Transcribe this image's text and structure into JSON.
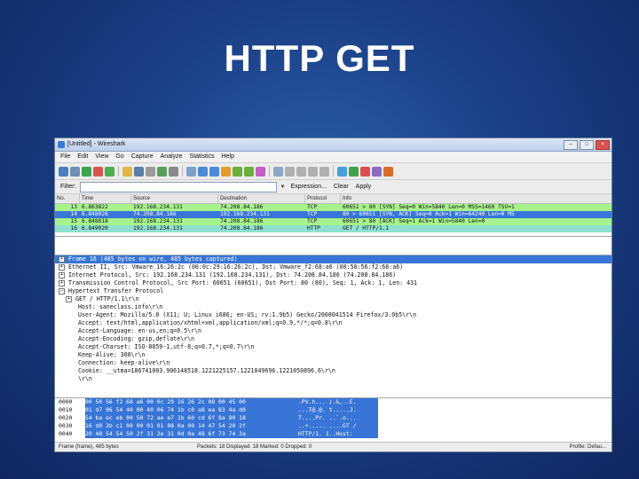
{
  "slide": {
    "title": "HTTP GET"
  },
  "window": {
    "title": "[Untitled] - Wireshark",
    "controls": {
      "minimize": "–",
      "maximize": "□",
      "close": "×"
    }
  },
  "menu": [
    "File",
    "Edit",
    "View",
    "Go",
    "Capture",
    "Analyze",
    "Statistics",
    "Help"
  ],
  "toolbar_icons": [
    {
      "name": "interfaces-icon",
      "color": "#4a7fbf"
    },
    {
      "name": "options-icon",
      "color": "#6f8fb3"
    },
    {
      "name": "start-capture-icon",
      "color": "#3fa34d"
    },
    {
      "name": "stop-capture-icon",
      "color": "#d9534f"
    },
    {
      "name": "restart-capture-icon",
      "color": "#4caf50"
    },
    {
      "name": "open-icon",
      "color": "#e3b448"
    },
    {
      "name": "save-icon",
      "color": "#5b7fa6"
    },
    {
      "name": "close-file-icon",
      "color": "#9b9b9b"
    },
    {
      "name": "reload-icon",
      "color": "#5a9e5a"
    },
    {
      "name": "print-icon",
      "color": "#8a8a8a"
    },
    {
      "name": "find-icon",
      "color": "#7da0c9"
    },
    {
      "name": "go-back-icon",
      "color": "#4b8bd6"
    },
    {
      "name": "go-forward-icon",
      "color": "#4b8bd6"
    },
    {
      "name": "go-to-packet-icon",
      "color": "#e39b2b"
    },
    {
      "name": "go-first-icon",
      "color": "#6aaf3a"
    },
    {
      "name": "go-last-icon",
      "color": "#6aaf3a"
    },
    {
      "name": "colorize-icon",
      "color": "#c25ec4"
    },
    {
      "name": "auto-scroll-icon",
      "color": "#8ea7c4"
    },
    {
      "name": "zoom-in-icon",
      "color": "#b0b0b0"
    },
    {
      "name": "zoom-out-icon",
      "color": "#b0b0b0"
    },
    {
      "name": "normal-size-icon",
      "color": "#b0b0b0"
    },
    {
      "name": "resize-columns-icon",
      "color": "#b0b0b0"
    },
    {
      "name": "capture-filters-icon",
      "color": "#46a0d8"
    },
    {
      "name": "display-filters-icon",
      "color": "#3fa34d"
    },
    {
      "name": "coloring-rules-icon",
      "color": "#d94f4f"
    },
    {
      "name": "preferences-icon",
      "color": "#8a6bbf"
    },
    {
      "name": "help-icon",
      "color": "#d96b2b"
    }
  ],
  "filter": {
    "label": "Filter:",
    "value": "",
    "dropdown": "▼",
    "expression": "Expression...",
    "clear": "Clear",
    "apply": "Apply"
  },
  "packet_list": {
    "columns": [
      "No.",
      "Time",
      "Source",
      "Destination",
      "Protocol",
      "Info"
    ],
    "rows": [
      {
        "no": "13",
        "time": "6.863822",
        "src": "192.168.234.131",
        "dst": "74.208.84.186",
        "proto": "TCP",
        "info": "60651 > 80 [SYN] Seq=0 Win=5840 Len=0 MSS=1460 TSV=1",
        "style": "tcp"
      },
      {
        "no": "14",
        "time": "6.848026",
        "src": "74.208.84.186",
        "dst": "192.168.234.131",
        "proto": "TCP",
        "info": "80 > 60651 [SYN, ACK] Seq=0 Ack=1 Win=64240 Len=0 MS",
        "style": "sel"
      },
      {
        "no": "15",
        "time": "6.848818",
        "src": "192.168.234.131",
        "dst": "74.208.84.186",
        "proto": "TCP",
        "info": "60651 > 80 [ACK] Seq=1 Ack=1 Win=5840 Len=0",
        "style": "tcp"
      },
      {
        "no": "16",
        "time": "6.849020",
        "src": "192.168.234.131",
        "dst": "74.208.84.186",
        "proto": "HTTP",
        "info": "GET / HTTP/1.1",
        "style": "http"
      }
    ]
  },
  "details": [
    {
      "text": "Frame 16 (485 bytes on wire, 485 bytes captured)",
      "level": 0,
      "exp": "+",
      "sel": true
    },
    {
      "text": "Ethernet II, Src: Vmware_16:26:2c (00:0c:29:16:26:2c), Dst: Vmware_f2:68:a6 (00:50:56:f2:68:a6)",
      "level": 0,
      "exp": "+",
      "sel": false
    },
    {
      "text": "Internet Protocol, Src: 192.168.234.131 (192.168.234.131), Dst: 74.208.84.186 (74.208.84.186)",
      "level": 0,
      "exp": "+",
      "sel": false
    },
    {
      "text": "Transmission Control Protocol, Src Port: 60651 (60651), Dst Port: 80 (80), Seq: 1, Ack: 1, Len: 431",
      "level": 0,
      "exp": "+",
      "sel": false
    },
    {
      "text": "Hypertext Transfer Protocol",
      "level": 0,
      "exp": "−",
      "sel": false
    },
    {
      "text": "GET / HTTP/1.1\\r\\n",
      "level": 1,
      "exp": "+",
      "sel": false
    },
    {
      "text": "Host: saneclass.info\\r\\n",
      "level": 2,
      "exp": "",
      "sel": false
    },
    {
      "text": "User-Agent: Mozilla/5.0 (X11; U; Linux i686; en-US; rv:1.9b5) Gecko/2008041514 Firefox/3.0b5\\r\\n",
      "level": 2,
      "exp": "",
      "sel": false
    },
    {
      "text": "Accept: text/html,application/xhtml+xml,application/xml;q=0.9,*/*;q=0.8\\r\\n",
      "level": 2,
      "exp": "",
      "sel": false
    },
    {
      "text": "Accept-Language: en-us,en;q=0.5\\r\\n",
      "level": 2,
      "exp": "",
      "sel": false
    },
    {
      "text": "Accept-Encoding: gzip,deflate\\r\\n",
      "level": 2,
      "exp": "",
      "sel": false
    },
    {
      "text": "Accept-Charset: ISO-8859-1,utf-8;q=0.7,*;q=0.7\\r\\n",
      "level": 2,
      "exp": "",
      "sel": false
    },
    {
      "text": "Keep-Alive: 300\\r\\n",
      "level": 2,
      "exp": "",
      "sel": false
    },
    {
      "text": "Connection: keep-alive\\r\\n",
      "level": 2,
      "exp": "",
      "sel": false
    },
    {
      "text": "Cookie: __utma=186741003.906148518.1221225157.1221049696.1221050896.6\\r\\n",
      "level": 2,
      "exp": "",
      "sel": false
    },
    {
      "text": "\\r\\n",
      "level": 2,
      "exp": "",
      "sel": false
    }
  ],
  "bytes": [
    {
      "off": "0000",
      "hex": "00 50 56 f2 68 a6 00 0c  29 16 26 2c 08 00 45 00",
      "ascii": ".PV.h... ).&,..E."
    },
    {
      "off": "0010",
      "hex": "01 d7 06 54 40 00 40 06  74 1b c0 a8 ea 83 4a d0",
      "ascii": "...T@.@. t.....J."
    },
    {
      "off": "0020",
      "hex": "54 ba ec eb 00 50 72 ae  e7 1b 60 cd 6f 8a 80 18",
      "ascii": "T....Pr. ..`.o..."
    },
    {
      "off": "0030",
      "hex": "16 d0 2b c1 00 00 01 01  08 0a 00 14 47 54 20 2f",
      "ascii": "..+..... ....GT /"
    },
    {
      "off": "0040",
      "hex": "20 48 54 54 50 2f 31 2e  31 0d 0a 48 6f 73 74 3a",
      "ascii": " HTTP/1. 1..Host:"
    }
  ],
  "status": {
    "left": "Frame (frame), 485 bytes",
    "middle": "Packets: 18 Displayed: 18 Marked: 0 Dropped: 0",
    "right": "Profile: Defau..."
  }
}
